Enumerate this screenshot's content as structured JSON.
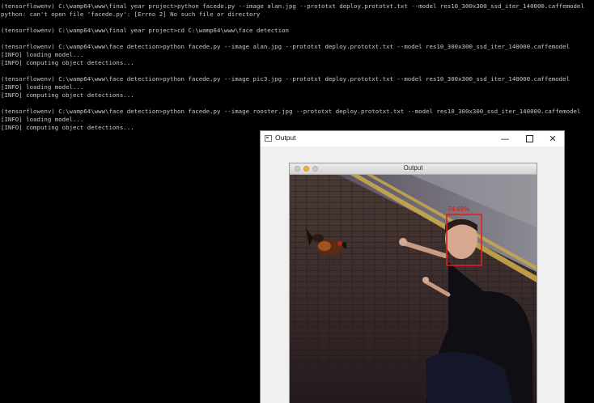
{
  "terminal": {
    "lines": [
      "(tensorflowenv) C:\\wamp64\\www\\final year project>python facede.py --image alan.jpg --prototxt deploy.prototxt.txt --model res10_300x300_ssd_iter_140000.caffemodel",
      "python: can't open file 'facede.py': [Errno 2] No such file or directory",
      "",
      "(tensorflowenv) C:\\wamp64\\www\\final year project>cd C:\\wamp64\\www\\face detection",
      "",
      "(tensorflowenv) C:\\wamp64\\www\\face detection>python facede.py --image alan.jpg --prototxt deploy.prototxt.txt --model res10_300x300_ssd_iter_140000.caffemodel",
      "[INFO] loading model...",
      "[INFO] computing object detections...",
      "",
      "(tensorflowenv) C:\\wamp64\\www\\face detection>python facede.py --image pic3.jpg --prototxt deploy.prototxt.txt --model res10_300x300_ssd_iter_140000.caffemodel",
      "[INFO] loading model...",
      "[INFO] computing object detections...",
      "",
      "(tensorflowenv) C:\\wamp64\\www\\face detection>python facede.py --image rooster.jpg --prototxt deploy.prototxt.txt --model res10_300x300_ssd_iter_140000.caffemodel",
      "[INFO] loading model...",
      "[INFO] computing object detections..."
    ]
  },
  "output_window": {
    "title": "Output",
    "minimize_glyph": "—",
    "close_glyph": "✕",
    "inner_title": "Output",
    "detection_label": "74.69%",
    "accent_color": "#e0201c"
  }
}
